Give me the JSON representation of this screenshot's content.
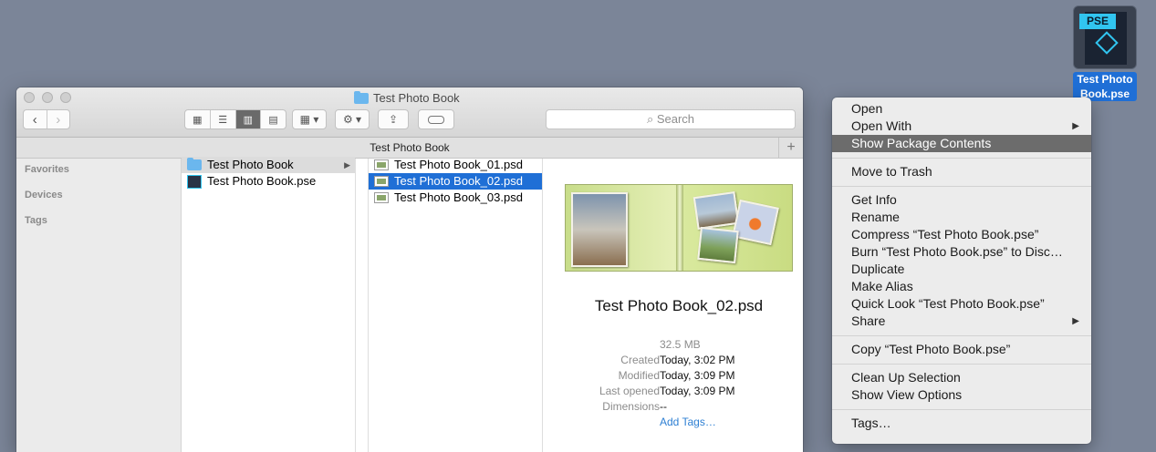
{
  "desktop": {
    "icon_badge": "PSE",
    "icon_label": "Test Photo Book.pse"
  },
  "window": {
    "title": "Test Photo Book",
    "search_placeholder": "Search",
    "path_title": "Test Photo Book",
    "view_modes": [
      "icon-view",
      "list-view",
      "column-view",
      "cover-flow-view"
    ],
    "active_view": "column-view"
  },
  "sidebar": {
    "sections": [
      "Favorites",
      "Devices",
      "Tags"
    ]
  },
  "column1": {
    "items": [
      {
        "label": "Test Photo Book",
        "icon": "folder-icon",
        "selected": true
      },
      {
        "label": "Test Photo Book.pse",
        "icon": "pse-file-icon",
        "selected": false
      }
    ]
  },
  "column2": {
    "items": [
      {
        "label": "Test Photo Book_01.psd",
        "icon": "psd-file-icon",
        "selected": false
      },
      {
        "label": "Test Photo Book_02.psd",
        "icon": "psd-file-icon",
        "selected": true
      },
      {
        "label": "Test Photo Book_03.psd",
        "icon": "psd-file-icon",
        "selected": false
      }
    ]
  },
  "preview": {
    "filename": "Test Photo Book_02.psd",
    "size": "32.5 MB",
    "fields": [
      {
        "key": "Created",
        "value": "Today, 3:02 PM"
      },
      {
        "key": "Modified",
        "value": "Today, 3:09 PM"
      },
      {
        "key": "Last opened",
        "value": "Today, 3:09 PM"
      },
      {
        "key": "Dimensions",
        "value": "--"
      }
    ],
    "add_tags": "Add Tags…"
  },
  "context_menu": {
    "items": [
      {
        "label": "Open"
      },
      {
        "label": "Open With",
        "submenu": true
      },
      {
        "label": "Show Package Contents",
        "highlighted": true
      },
      {
        "label": "Move to Trash"
      },
      {
        "label": "Get Info"
      },
      {
        "label": "Rename"
      },
      {
        "label": "Compress “Test Photo Book.pse”"
      },
      {
        "label": "Burn “Test Photo Book.pse” to Disc…"
      },
      {
        "label": "Duplicate"
      },
      {
        "label": "Make Alias"
      },
      {
        "label": "Quick Look “Test Photo Book.pse”"
      },
      {
        "label": "Share",
        "submenu": true
      },
      {
        "label": "Copy “Test Photo Book.pse”"
      },
      {
        "label": "Clean Up Selection"
      },
      {
        "label": "Show View Options"
      },
      {
        "label": "Tags…"
      }
    ]
  },
  "colors": {
    "selection": "#1f6fd6",
    "menu_highlight": "#6c6c6c",
    "link": "#2d7fd3",
    "desktop": "#7b8598"
  }
}
